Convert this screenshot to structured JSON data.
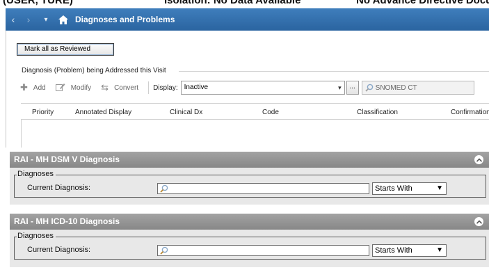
{
  "top_strip": {
    "left_text": "(USER, TURE)",
    "mid_text": "Isolation: No Data Available",
    "right_text": "No Advance Directive Document"
  },
  "navbar": {
    "back_glyph": "‹",
    "forward_glyph": "›",
    "menu_glyph": "▾",
    "title": "Diagnoses and Problems",
    "icons": {
      "home": "home-icon"
    }
  },
  "diagnoses_panel": {
    "review_button": "Mark all as Reviewed",
    "group_label": "Diagnosis (Problem) being Addressed this Visit",
    "toolbar": {
      "add_label": "Add",
      "modify_label": "Modify",
      "convert_label": "Convert",
      "display_label": "Display:",
      "display_value": "Inactive",
      "ellipsis_label": "...",
      "snomed_value": "SNOMED CT"
    },
    "columns": [
      "Priority",
      "Annotated Display",
      "Clinical Dx",
      "Code",
      "Classification",
      "Confirmation"
    ]
  },
  "rai_sections": [
    {
      "title": "RAI - MH DSM V Diagnosis",
      "group_legend": "Diagnoses",
      "field_label": "Current Diagnosis:",
      "search_value": "",
      "match_option": "Starts With"
    },
    {
      "title": "RAI - MH ICD-10 Diagnosis",
      "group_legend": "Diagnoses",
      "field_label": "Current Diagnosis:",
      "search_value": "",
      "match_option": "Starts With"
    }
  ],
  "colors": {
    "navbar": "#2f6dac",
    "section_header": "#959595",
    "section_body": "#e8e8e8"
  }
}
